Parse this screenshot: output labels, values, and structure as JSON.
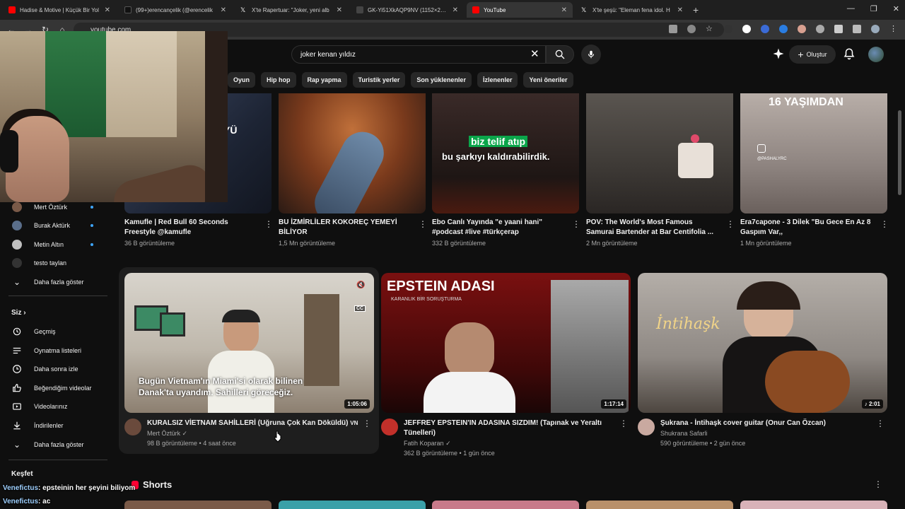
{
  "browser": {
    "tabs": [
      {
        "title": "Hadise & Motive | Küçük Bir Yol",
        "favicon_color": "#ff0000"
      },
      {
        "title": "(99+)erencançelik (@erencelik",
        "favicon_color": "#111111"
      },
      {
        "title": "X'te Rapertuar: \"Joker, yeni alb",
        "favicon_color": "#000000"
      },
      {
        "title": "GK-Yi51XkAQP9NV (1152×2048)",
        "favicon_color": "#444444"
      },
      {
        "title": "YouTube",
        "favicon_color": "#ff0000"
      },
      {
        "title": "X'te şeşü: \"Eleman fena idol. H",
        "favicon_color": "#000000"
      }
    ],
    "url": "youtube.com"
  },
  "header": {
    "search_value": "joker kenan yıldız",
    "create_label": "Oluştur"
  },
  "chips": [
    "Oyun",
    "Hip hop",
    "Rap yapma",
    "Turistik yerler",
    "Son yüklenenler",
    "İzlenenler",
    "Yeni öneriler"
  ],
  "sidebar": {
    "subscriptions": [
      {
        "label": "Mert Öztürk",
        "new": true
      },
      {
        "label": "Burak Aktürk",
        "new": true
      },
      {
        "label": "Metin Altın",
        "new": true
      },
      {
        "label": "testo taylan",
        "new": false
      }
    ],
    "subs_more": "Daha fazla göster",
    "you_title": "Siz",
    "you_items": [
      {
        "label": "Geçmiş",
        "icon": "history-icon"
      },
      {
        "label": "Oynatma listeleri",
        "icon": "playlist-icon"
      },
      {
        "label": "Daha sonra izle",
        "icon": "watch-later-icon"
      },
      {
        "label": "Beğendiğim videolar",
        "icon": "like-icon"
      },
      {
        "label": "Videolarınız",
        "icon": "your-videos-icon"
      },
      {
        "label": "İndirilenler",
        "icon": "download-icon"
      }
    ],
    "you_more": "Daha fazla göster",
    "explore_title": "Keşfet"
  },
  "top_videos": [
    {
      "title": "Kamufle | Red Bull 60 Seconds Freestyle @kamufle",
      "meta": "36 B görüntüleme",
      "overlay": "YÜ"
    },
    {
      "title": "BU İZMİRLİLER KOKOREÇ YEMEYİ BİLİYOR",
      "meta": "1,5 Mn görüntüleme",
      "overlay": ""
    },
    {
      "title": "Ebo Canlı Yayında \"e yaani hani\" #podcast #live #türkçerap",
      "meta": "332 B görüntüleme",
      "overlay_a": "biz telif atıp",
      "overlay_b": "bu şarkıyı kaldırabilirdik."
    },
    {
      "title": "POV: The World's Most Famous Samurai Bartender at Bar Centifolia ...",
      "meta": "2 Mn görüntüleme",
      "overlay": ""
    },
    {
      "title": "Era7capone - 3 Dilek \"Bu Gece  En Az 8 Gaspım Var,,",
      "meta": "1 Mn görüntüleme",
      "overlay": "16 YAŞIMDAN",
      "overlay_small": "@PASHALYRC"
    }
  ],
  "main_videos": [
    {
      "title": "KURALSIZ VİETNAM SAHİLLERİ (Uğruna Çok Kan Döküldü)",
      "title_suffix": "VN",
      "channel": "Mert Öztürk",
      "meta": "98 B görüntüleme • 4 saat önce",
      "duration": "1:05:06",
      "caption_line1": "Bugün Vietnam'ın Miami'si olarak bilinen",
      "caption_line2": "Danak'ta uyandım. Sahilleri göreceğiz.",
      "cc_label": "CC"
    },
    {
      "title": "JEFFREY EPSTEIN'IN ADASINA SIZDIM! (Tapınak ve Yeraltı Tünelleri)",
      "channel": "Fatih Koparan",
      "meta": "362 B görüntüleme • 1 gün önce",
      "duration": "1:17:14",
      "thumb_title": "EPSTEIN ADASI",
      "thumb_sub": "KARANLIK BİR SORUŞTURMA"
    },
    {
      "title": "Şukrana - İntihaşk cover guitar (Onur Can Özcan)",
      "channel": "Shukrana Safarli",
      "meta": "590 görüntüleme • 2 gün önce",
      "duration": "2:01",
      "thumb_title": "İntihaşk"
    }
  ],
  "shorts_title": "Shorts",
  "chat": [
    {
      "user": "Venefictus",
      "message": ": epsteinin her şeyini biliyom"
    },
    {
      "user": "Venefictus",
      "message": ": ac"
    }
  ]
}
